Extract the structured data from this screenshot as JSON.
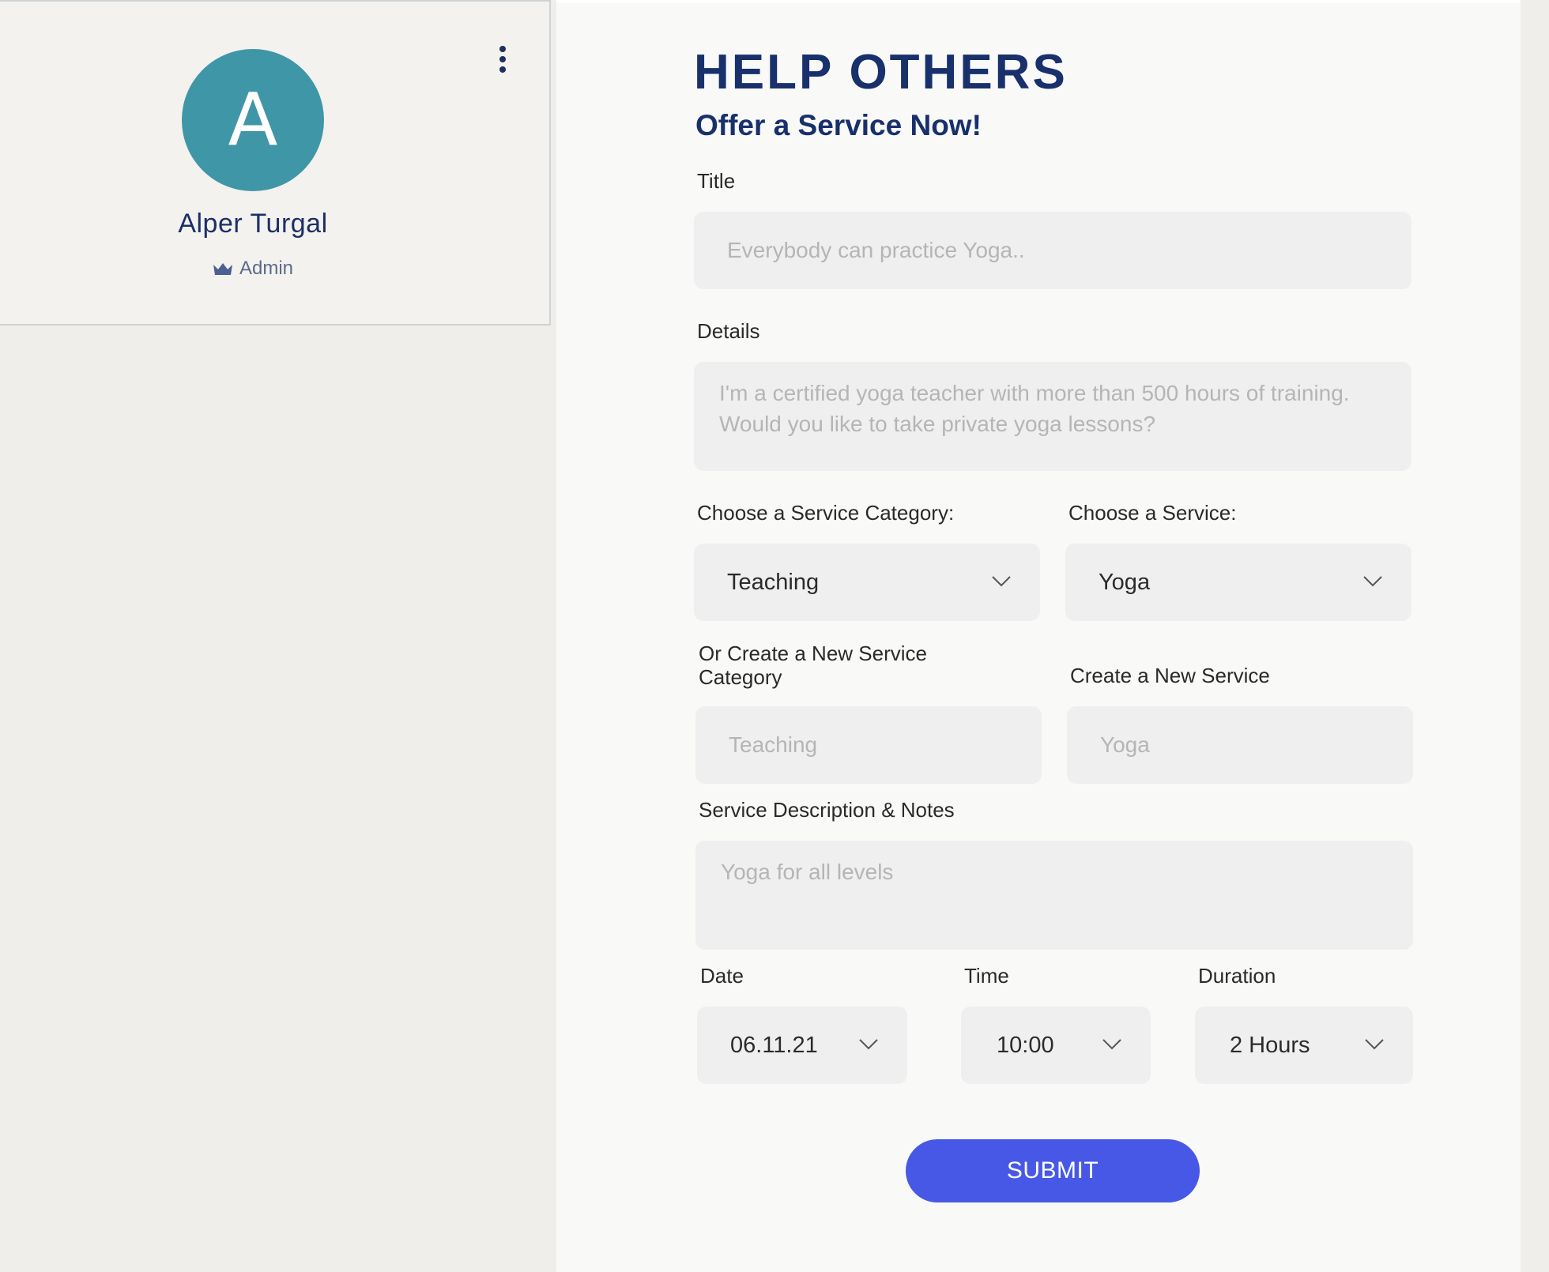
{
  "profile": {
    "avatar_letter": "A",
    "name": "Alper Turgal",
    "role": "Admin",
    "avatar_color": "#3f96a7",
    "menu_icon": "more-vertical-icon",
    "role_icon": "crown-icon"
  },
  "form": {
    "heading": "HELP OTHERS",
    "subheading": "Offer a Service Now!",
    "title_label": "Title",
    "title_placeholder": "Everybody can practice Yoga..",
    "details_label": "Details",
    "details_placeholder": "I'm a certified yoga teacher with more than 500 hours of training. Would you like to take private yoga lessons?",
    "category_label": "Choose a Service Category:",
    "category_value": "Teaching",
    "service_label": "Choose a Service:",
    "service_value": "Yoga",
    "new_category_label": "Or Create a New Service Category",
    "new_category_placeholder": "Teaching",
    "new_service_label": "Create a New Service",
    "new_service_placeholder": "Yoga",
    "description_label": "Service Description & Notes",
    "description_placeholder": "Yoga for all levels",
    "date_label": "Date",
    "date_value": "06.11.21",
    "time_label": "Time",
    "time_value": "10:00",
    "duration_label": "Duration",
    "duration_value": "2 Hours",
    "submit_label": "SUBMIT",
    "accent_color": "#4858e6",
    "heading_color": "#18306b"
  }
}
